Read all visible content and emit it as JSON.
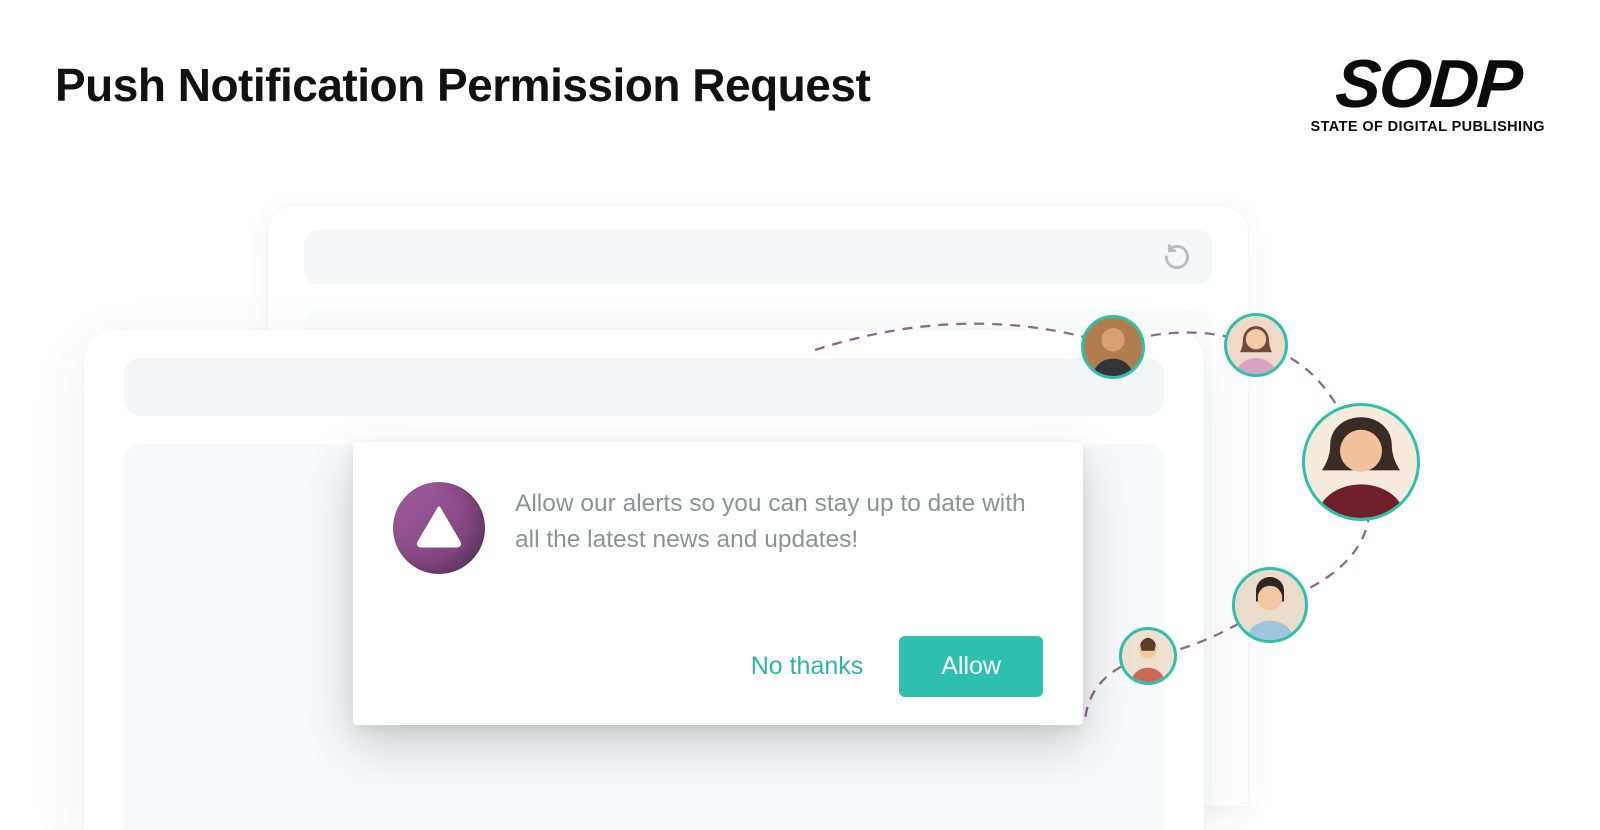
{
  "heading": "Push Notification Permission Request",
  "brand": {
    "name": "SODP",
    "tagline": "STATE OF DIGITAL PUBLISHING"
  },
  "dialog": {
    "message": "Allow our alerts so you can stay up to date with all the latest news and updates!",
    "decline": "No thanks",
    "accept": "Allow"
  },
  "colors": {
    "accent": "#2cc0ad",
    "icon_bg": "#8a4a88"
  }
}
